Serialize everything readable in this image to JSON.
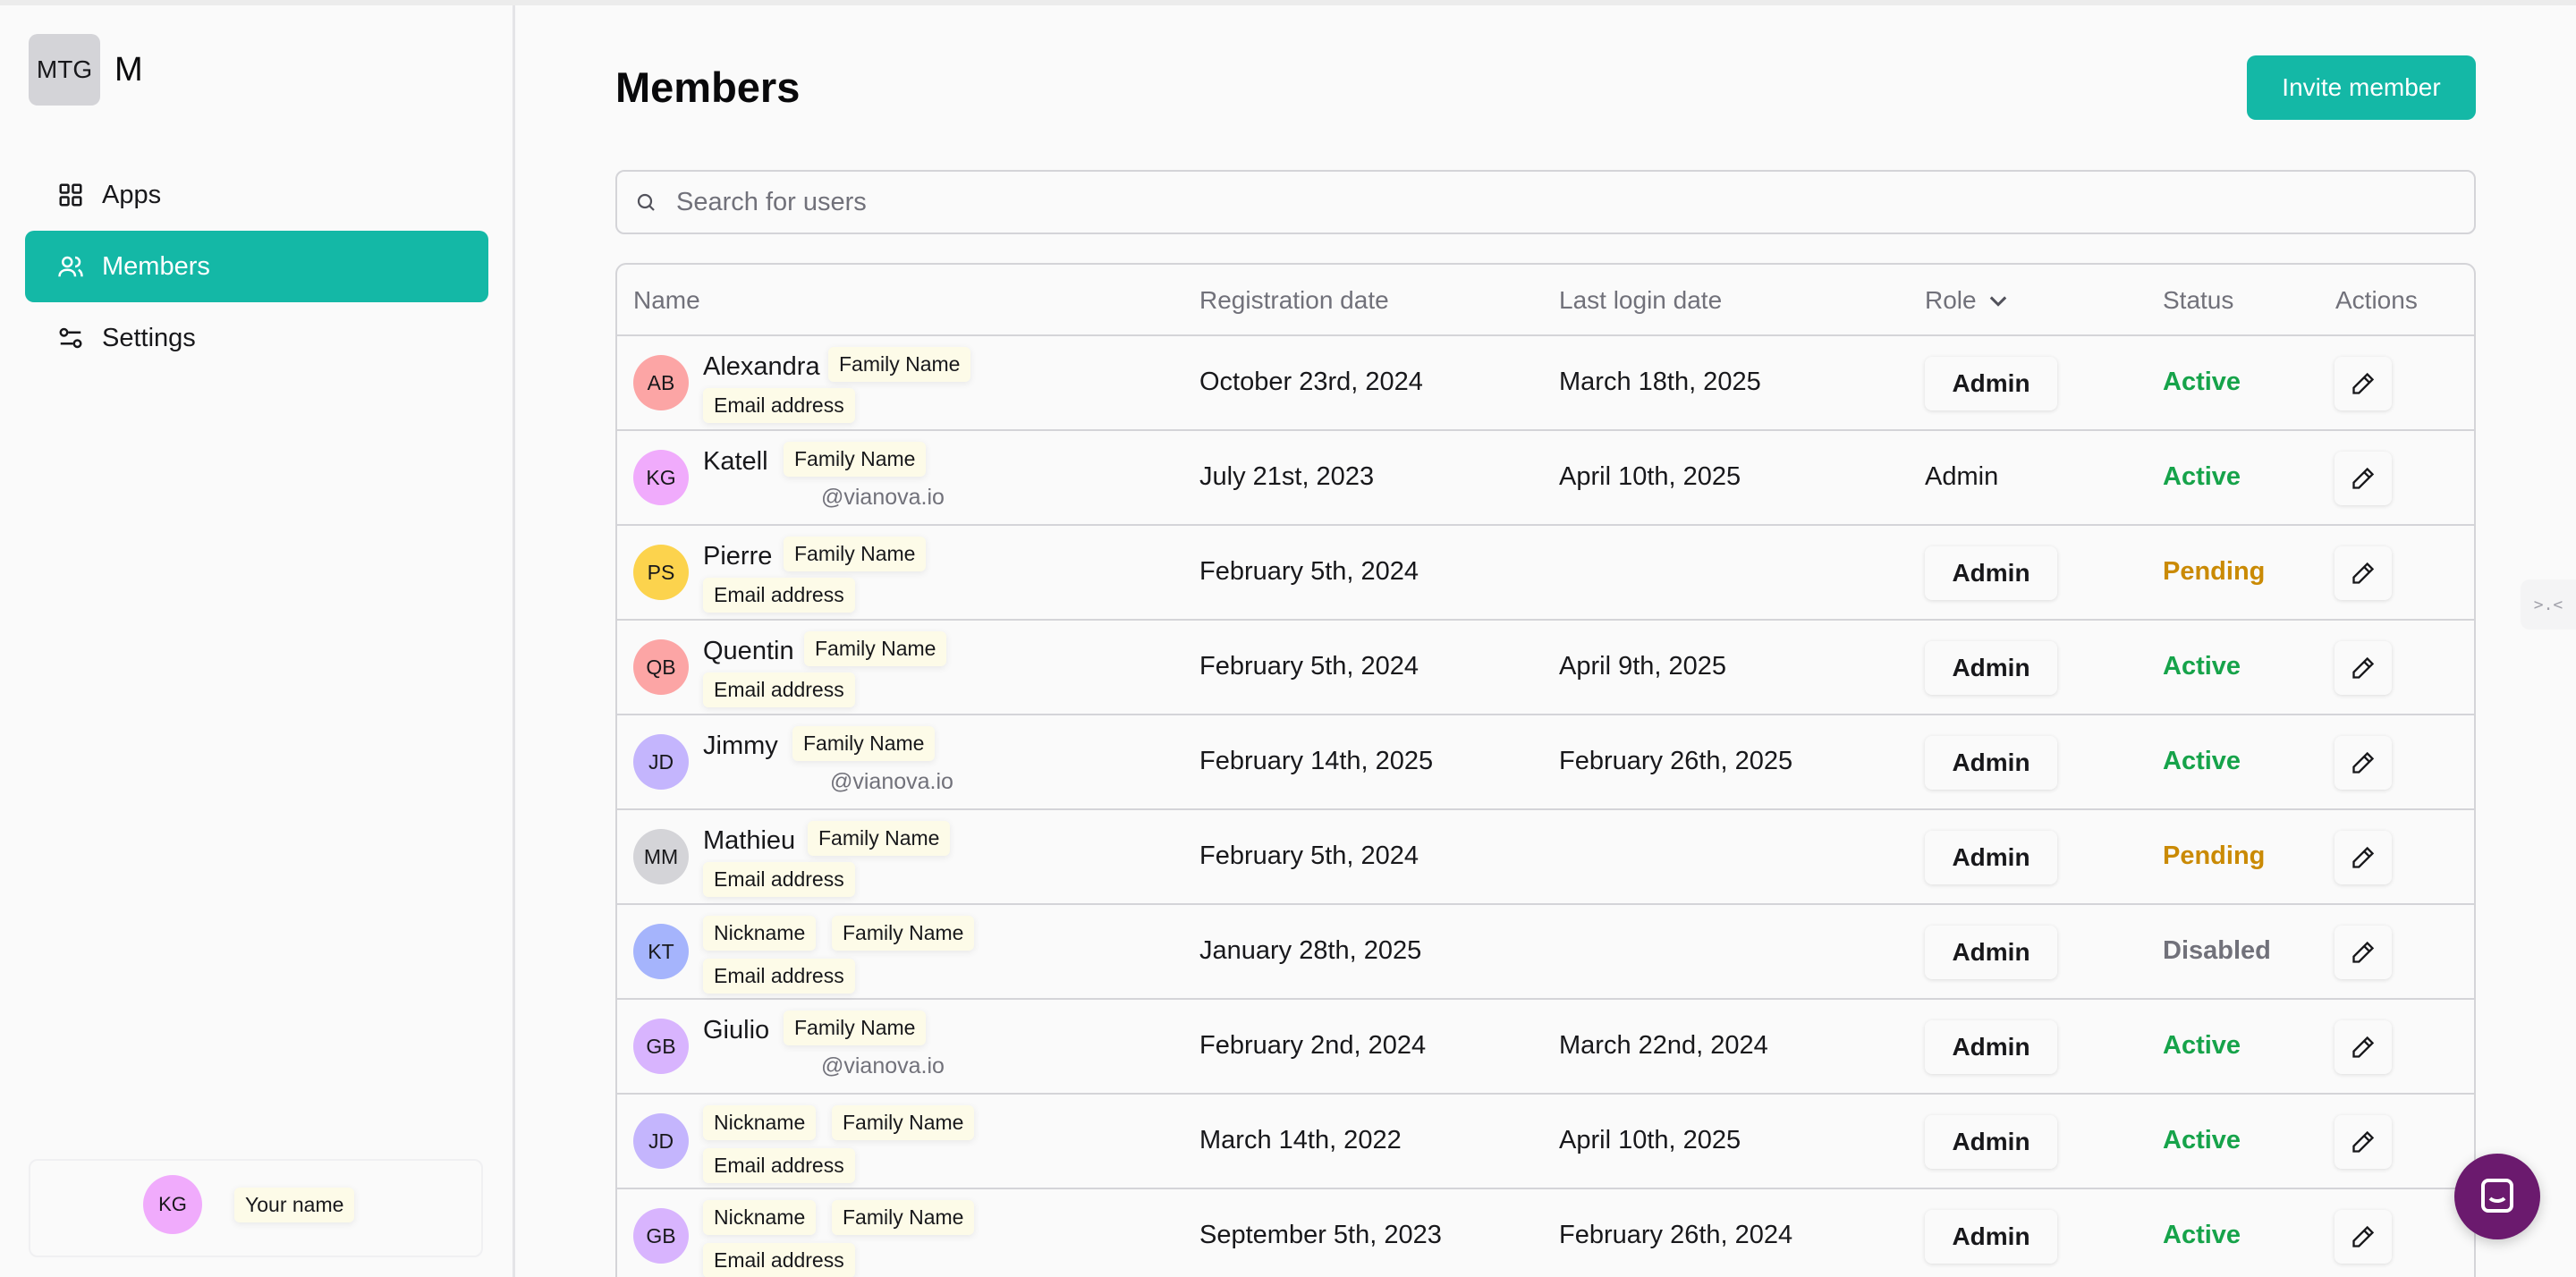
{
  "workspace": {
    "badge": "MTG",
    "name": "M"
  },
  "nav": [
    {
      "label": "Apps",
      "icon": "grid-icon",
      "active": false
    },
    {
      "label": "Members",
      "icon": "users-icon",
      "active": true
    },
    {
      "label": "Settings",
      "icon": "sliders-icon",
      "active": false
    }
  ],
  "current_user": {
    "initials": "KG",
    "name_placeholder": "Your name"
  },
  "page": {
    "title": "Members",
    "invite_label": "Invite member",
    "search_placeholder": "Search for users"
  },
  "columns": {
    "name": "Name",
    "registration": "Registration date",
    "last_login": "Last login date",
    "role": "Role",
    "status": "Status",
    "actions": "Actions"
  },
  "colors": {
    "accent": "#14b8a6",
    "active": "#16a34a",
    "pending": "#ca8a04",
    "disabled": "#71717a"
  },
  "rows": [
    {
      "initials": "AB",
      "avatar_color": "#fca5a5",
      "first": "Alexandra",
      "nickname": "",
      "family": "Family Name",
      "sub": "Email address",
      "sub_type": "chip",
      "registered": "October 23rd, 2024",
      "last_login": "March 18th, 2025",
      "role": "Admin",
      "role_button": true,
      "status": "Active"
    },
    {
      "initials": "KG",
      "avatar_color": "#f0abfc",
      "first": "Katell",
      "nickname": "",
      "family": "Family Name",
      "sub": "@vianova.io",
      "sub_type": "domain",
      "registered": "July 21st, 2023",
      "last_login": "April 10th, 2025",
      "role": "Admin",
      "role_button": false,
      "status": "Active"
    },
    {
      "initials": "PS",
      "avatar_color": "#fcd34d",
      "first": "Pierre",
      "nickname": "",
      "family": "Family Name",
      "sub": "Email address",
      "sub_type": "chip",
      "registered": "February 5th, 2024",
      "last_login": "",
      "role": "Admin",
      "role_button": true,
      "status": "Pending"
    },
    {
      "initials": "QB",
      "avatar_color": "#fca5a5",
      "first": "Quentin",
      "nickname": "",
      "family": "Family Name",
      "sub": "Email address",
      "sub_type": "chip",
      "registered": "February 5th, 2024",
      "last_login": "April 9th, 2025",
      "role": "Admin",
      "role_button": true,
      "status": "Active"
    },
    {
      "initials": "JD",
      "avatar_color": "#c4b5fd",
      "first": "Jimmy",
      "nickname": "",
      "family": "Family Name",
      "sub": "@vianova.io",
      "sub_type": "domain",
      "registered": "February 14th, 2025",
      "last_login": "February 26th, 2025",
      "role": "Admin",
      "role_button": true,
      "status": "Active"
    },
    {
      "initials": "MM",
      "avatar_color": "#d4d4d8",
      "first": "Mathieu",
      "nickname": "",
      "family": "Family Name",
      "sub": "Email address",
      "sub_type": "chip",
      "registered": "February 5th, 2024",
      "last_login": "",
      "role": "Admin",
      "role_button": true,
      "status": "Pending"
    },
    {
      "initials": "KT",
      "avatar_color": "#a5b4fc",
      "first": "",
      "nickname": "Nickname",
      "family": "Family Name",
      "sub": "Email address",
      "sub_type": "chip",
      "registered": "January 28th, 2025",
      "last_login": "",
      "role": "Admin",
      "role_button": true,
      "status": "Disabled"
    },
    {
      "initials": "GB",
      "avatar_color": "#d8b4fe",
      "first": "Giulio",
      "nickname": "",
      "family": "Family Name",
      "sub": "@vianova.io",
      "sub_type": "domain",
      "registered": "February 2nd, 2024",
      "last_login": "March 22nd, 2024",
      "role": "Admin",
      "role_button": true,
      "status": "Active"
    },
    {
      "initials": "JD",
      "avatar_color": "#c4b5fd",
      "first": "",
      "nickname": "Nickname",
      "family": "Family Name",
      "sub": "Email address",
      "sub_type": "chip",
      "registered": "March 14th, 2022",
      "last_login": "April 10th, 2025",
      "role": "Admin",
      "role_button": true,
      "status": "Active"
    },
    {
      "initials": "GB",
      "avatar_color": "#d8b4fe",
      "first": "",
      "nickname": "Nickname",
      "family": "Family Name",
      "sub": "Email address",
      "sub_type": "chip",
      "registered": "September 5th, 2023",
      "last_login": "February 26th, 2024",
      "role": "Admin",
      "role_button": true,
      "status": "Active"
    }
  ],
  "side_tab": ">.<"
}
